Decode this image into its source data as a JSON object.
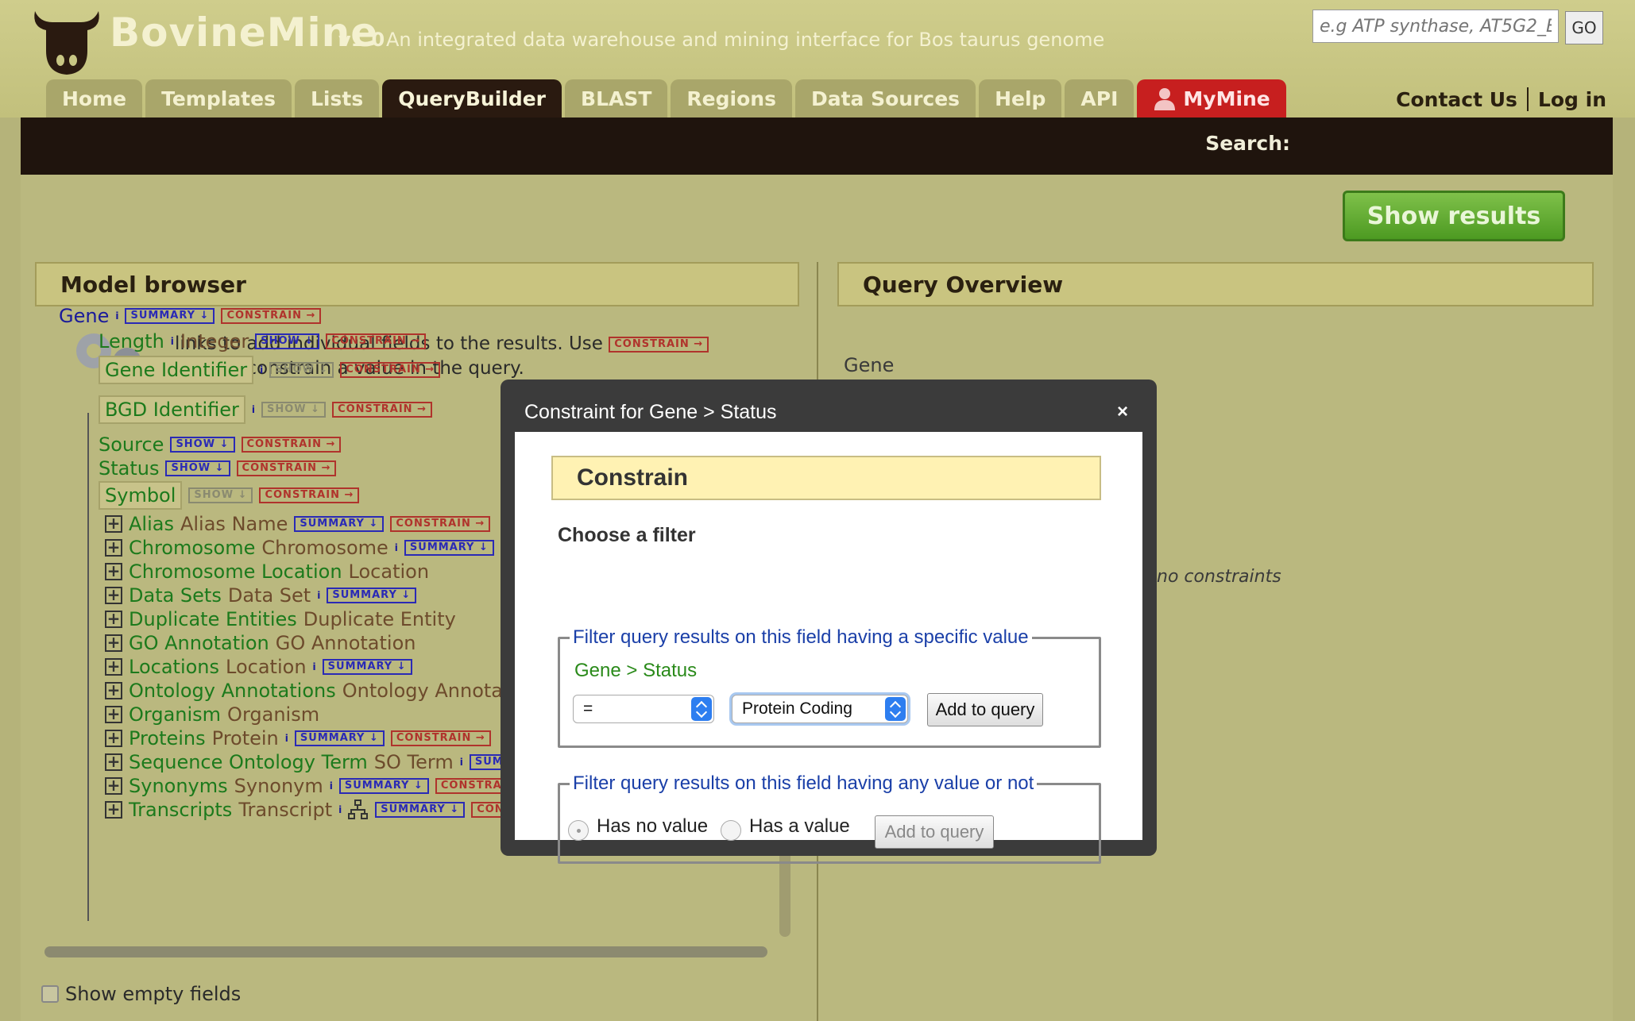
{
  "header": {
    "brand": "BovineMine",
    "version": "v1.0",
    "tagline": "An integrated data warehouse and mining interface for Bos taurus genome",
    "tabs": [
      "Home",
      "Templates",
      "Lists",
      "QueryBuilder",
      "BLAST",
      "Regions",
      "Data Sources",
      "Help",
      "API",
      "MyMine"
    ],
    "active_tab": "QueryBuilder",
    "contact_us": "Contact Us",
    "log_in": "Log in"
  },
  "search": {
    "label": "Search:",
    "placeholder": "e.g ATP synthase, AT5G2_E",
    "go": "GO"
  },
  "toolbar": {
    "show_results": "Show results"
  },
  "model_browser": {
    "title": "Model browser",
    "help_line1": "links to add individual fields to the results. Use",
    "help_line2": "links to constrain a value in the query.",
    "root": "Gene",
    "badges": {
      "summary": "SUMMARY ↓",
      "constrain": "CONSTRAIN →",
      "show": "SHOW ↓"
    },
    "fields": [
      {
        "name": "Length",
        "type": "Integer"
      },
      {
        "name": "Gene Identifier",
        "type": ""
      },
      {
        "name": "BGD Identifier",
        "type": ""
      },
      {
        "name": "Source",
        "type": ""
      },
      {
        "name": "Status",
        "type": ""
      },
      {
        "name": "Symbol",
        "type": ""
      }
    ],
    "references": [
      {
        "name": "Alias",
        "type": "Alias Name"
      },
      {
        "name": "Chromosome",
        "type": "Chromosome"
      },
      {
        "name": "Chromosome Location",
        "type": "Location"
      },
      {
        "name": "Data Sets",
        "type": "Data Set"
      },
      {
        "name": "Duplicate Entities",
        "type": "Duplicate Entity"
      },
      {
        "name": "GO Annotation",
        "type": "GO Annotation"
      },
      {
        "name": "Locations",
        "type": "Location"
      },
      {
        "name": "Ontology Annotations",
        "type": "Ontology Annotati"
      },
      {
        "name": "Organism",
        "type": "Organism"
      },
      {
        "name": "Proteins",
        "type": "Protein"
      },
      {
        "name": "Sequence Ontology Term",
        "type": "SO Term"
      },
      {
        "name": "Synonyms",
        "type": "Synonym"
      },
      {
        "name": "Transcripts",
        "type": "Transcript"
      }
    ],
    "show_empty_fields": "Show empty fields"
  },
  "query_overview": {
    "title": "Query Overview",
    "gene": "Gene",
    "no_constraints": "no constraints"
  },
  "dialog": {
    "title": "Constraint for Gene > Status",
    "close": "×",
    "constrain_heading": "Constrain",
    "choose_filter": "Choose a filter",
    "specific_legend": "Filter query results on this field having a specific value",
    "path": "Gene > Status",
    "operator": "=",
    "value": "Protein Coding",
    "add_to_query": "Add to query",
    "any_legend": "Filter query results on this field having any value or not",
    "has_no_value": "Has no value",
    "has_a_value": "Has a value",
    "selected_radio": "Has no value"
  },
  "colors": {
    "header_bg": "#c8c684",
    "searchbar_bg": "#1f140d",
    "show_results_green": "#5aa62c",
    "mymine_red": "#c71f1f",
    "legend_blue": "#1a3fa8",
    "path_green": "#2a8a1a",
    "constrain_yellow": "#fff2b3"
  }
}
